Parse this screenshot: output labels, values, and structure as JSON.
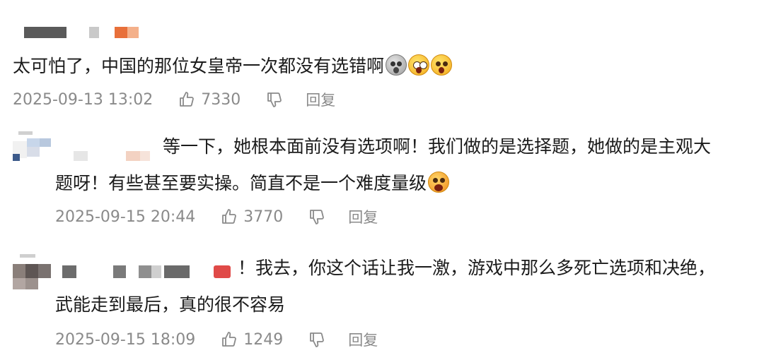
{
  "comments": [
    {
      "lines": [
        "太可怕了，中国的那位女皇帝一次都没有选错啊"
      ],
      "emojis": [
        "dizzy-face-icon",
        "surprised-face-icon",
        "scared-face-icon"
      ],
      "time": "2025-09-13 13:02",
      "likes": "7330",
      "reply": "回复"
    },
    {
      "lines": [
        "等一下，她根本面前没有选项啊！我们做的是选择题，她做的是主观大",
        "题呀！有些甚至要实操。简直不是一个难度量级"
      ],
      "emojis": [
        "shocked-face-icon"
      ],
      "time": "2025-09-15 20:44",
      "likes": "3770",
      "reply": "回复"
    },
    {
      "lines": [
        "！我去，你这个话让我一激，游戏中那么多死亡选项和决绝，",
        "武能走到最后，真的很不容易"
      ],
      "emojis": [],
      "time": "2025-09-15 18:09",
      "likes": "1249",
      "reply": "回复"
    }
  ],
  "colors": {
    "text": "#1b1b1b",
    "meta": "#8a8a8a",
    "accent_orange": "#e8703a",
    "accent_red": "#e04a48"
  }
}
